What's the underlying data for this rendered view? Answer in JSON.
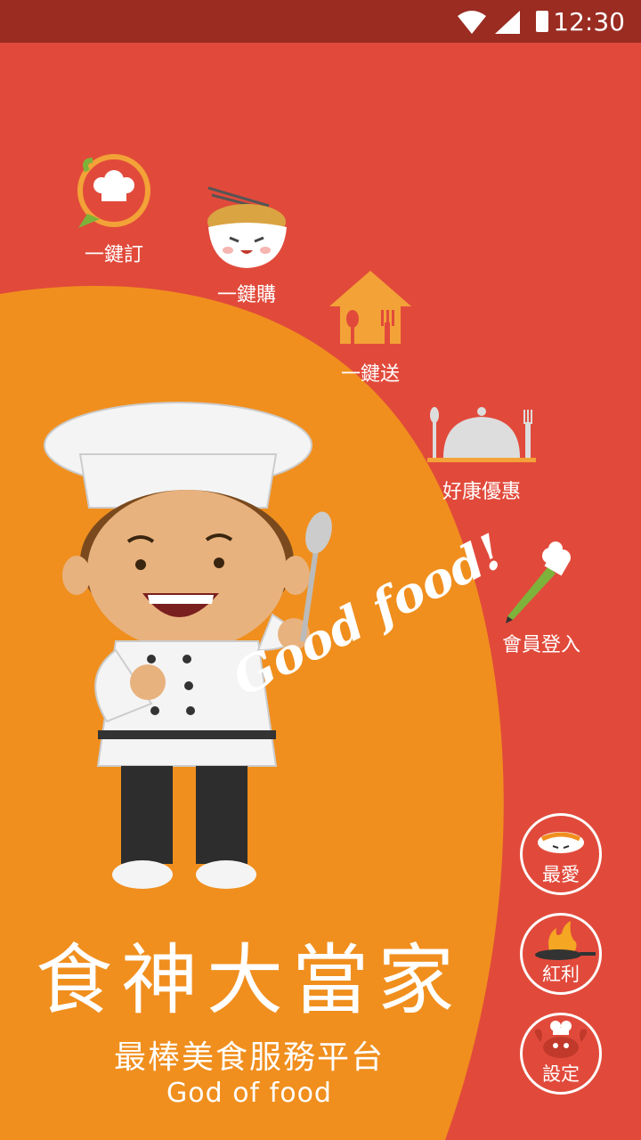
{
  "status_bar": {
    "time": "12:30"
  },
  "menu": {
    "order": "一鍵訂",
    "buy": "一鍵購",
    "deliver": "一鍵送",
    "deals": "好康優惠",
    "login": "會員登入"
  },
  "brand": {
    "slogan_art": "Good food!",
    "title": "食神大當家",
    "subtitle": "最棒美食服務平台",
    "english": "God of food"
  },
  "side_buttons": {
    "favorites": "最愛",
    "bonus": "紅利",
    "settings": "設定"
  },
  "colors": {
    "background": "#e14a3b",
    "accent": "#f08f1e",
    "status_bar": "#9a2c22"
  }
}
